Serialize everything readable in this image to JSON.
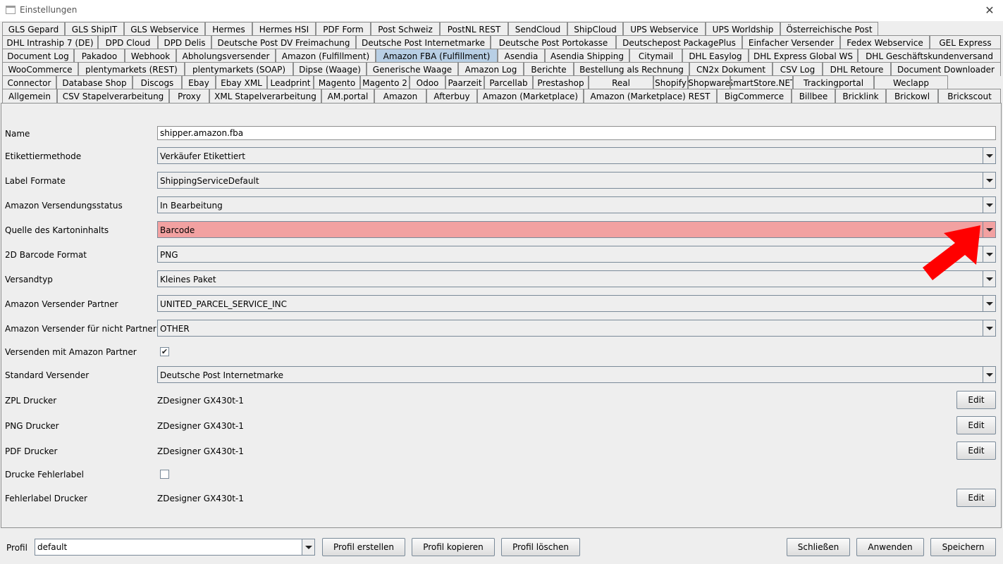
{
  "window": {
    "title": "Einstellungen"
  },
  "tab_rows": [
    [
      "GLS Gepard",
      "GLS ShipIT",
      "GLS Webservice",
      "Hermes",
      "Hermes HSI",
      "PDF Form",
      "Post Schweiz",
      "PostNL REST",
      "SendCloud",
      "ShipCloud",
      "UPS Webservice",
      "UPS Worldship",
      "Österreichische Post"
    ],
    [
      "DHL Intraship 7 (DE)",
      "DPD Cloud",
      "DPD Delis",
      "Deutsche Post DV Freimachung",
      "Deutsche Post Internetmarke",
      "Deutsche Post Portokasse",
      "Deutschepost PackagePlus",
      "Einfacher Versender",
      "Fedex Webservice",
      "GEL Express"
    ],
    [
      "Document Log",
      "Pakadoo",
      "Webhook",
      "Abholungsversender",
      "Amazon (Fulfillment)",
      "Amazon FBA (Fulfillment)",
      "Asendia",
      "Asendia Shipping",
      "Citymail",
      "DHL Easylog",
      "DHL Express Global WS",
      "DHL Geschäftskundenversand"
    ],
    [
      "WooCommerce",
      "plentymarkets (REST)",
      "plentymarkets (SOAP)",
      "Dipse (Waage)",
      "Generische Waage",
      "Amazon Log",
      "Berichte",
      "Bestellung als Rechnung",
      "CN2x Dokument",
      "CSV Log",
      "DHL Retoure",
      "Document Downloader"
    ],
    [
      "Connector",
      "Database Shop",
      "Discogs",
      "Ebay",
      "Ebay XML",
      "Leadprint",
      "Magento",
      "Magento 2",
      "Odoo",
      "Paarzeit",
      "Parcellab",
      "Prestashop",
      "Real",
      "Shopify",
      "Shopware",
      "SmartStore.NET",
      "Trackingportal",
      "Weclapp"
    ],
    [
      "Allgemein",
      "CSV Stapelverarbeitung",
      "Proxy",
      "XML Stapelverarbeitung",
      "AM.portal",
      "Amazon",
      "Afterbuy",
      "Amazon (Marketplace)",
      "Amazon (Marketplace) REST",
      "BigCommerce",
      "Billbee",
      "Bricklink",
      "Brickowl",
      "Brickscout"
    ]
  ],
  "active_tab": "Amazon FBA (Fulfillment)",
  "form": {
    "name": {
      "label": "Name",
      "value": "shipper.amazon.fba"
    },
    "etikettiermethode": {
      "label": "Etikettiermethode",
      "value": "Verkäufer Etikettiert"
    },
    "label_formate": {
      "label": "Label Formate",
      "value": "ShippingServiceDefault"
    },
    "versendungsstatus": {
      "label": "Amazon Versendungsstatus",
      "value": "In Bearbeitung"
    },
    "kartoninhalt": {
      "label": "Quelle des Kartoninhalts",
      "value": "Barcode",
      "highlight_color": "#f2a1a1"
    },
    "barcode_format": {
      "label": "2D Barcode Format",
      "value": "PNG"
    },
    "versandtyp": {
      "label": "Versandtyp",
      "value": "Kleines Paket"
    },
    "versender_partner": {
      "label": "Amazon Versender Partner",
      "value": "UNITED_PARCEL_SERVICE_INC"
    },
    "versender_nicht_partner": {
      "label": "Amazon Versender für nicht Partner",
      "value": "OTHER"
    },
    "versenden_mit_partner": {
      "label": "Versenden mit Amazon Partner",
      "checked": true
    },
    "standard_versender": {
      "label": "Standard Versender",
      "value": "Deutsche Post Internetmarke"
    },
    "zpl_drucker": {
      "label": "ZPL Drucker",
      "value": "ZDesigner GX430t-1",
      "button": "Edit"
    },
    "png_drucker": {
      "label": "PNG Drucker",
      "value": "ZDesigner GX430t-1",
      "button": "Edit"
    },
    "pdf_drucker": {
      "label": "PDF Drucker",
      "value": "ZDesigner GX430t-1",
      "button": "Edit"
    },
    "drucke_fehlerlabel": {
      "label": "Drucke Fehlerlabel",
      "checked": false
    },
    "fehlerlabel_drucker": {
      "label": "Fehlerlabel Drucker",
      "value": "ZDesigner GX430t-1",
      "button": "Edit"
    }
  },
  "footer": {
    "profil_label": "Profil",
    "profil_value": "default",
    "profil_erstellen": "Profil erstellen",
    "profil_kopieren": "Profil kopieren",
    "profil_loeschen": "Profil löschen",
    "schliessen": "Schließen",
    "anwenden": "Anwenden",
    "speichern": "Speichern"
  },
  "annotation": {
    "arrow_color": "#ff0000",
    "arrow_icon": "red-arrow-icon"
  }
}
